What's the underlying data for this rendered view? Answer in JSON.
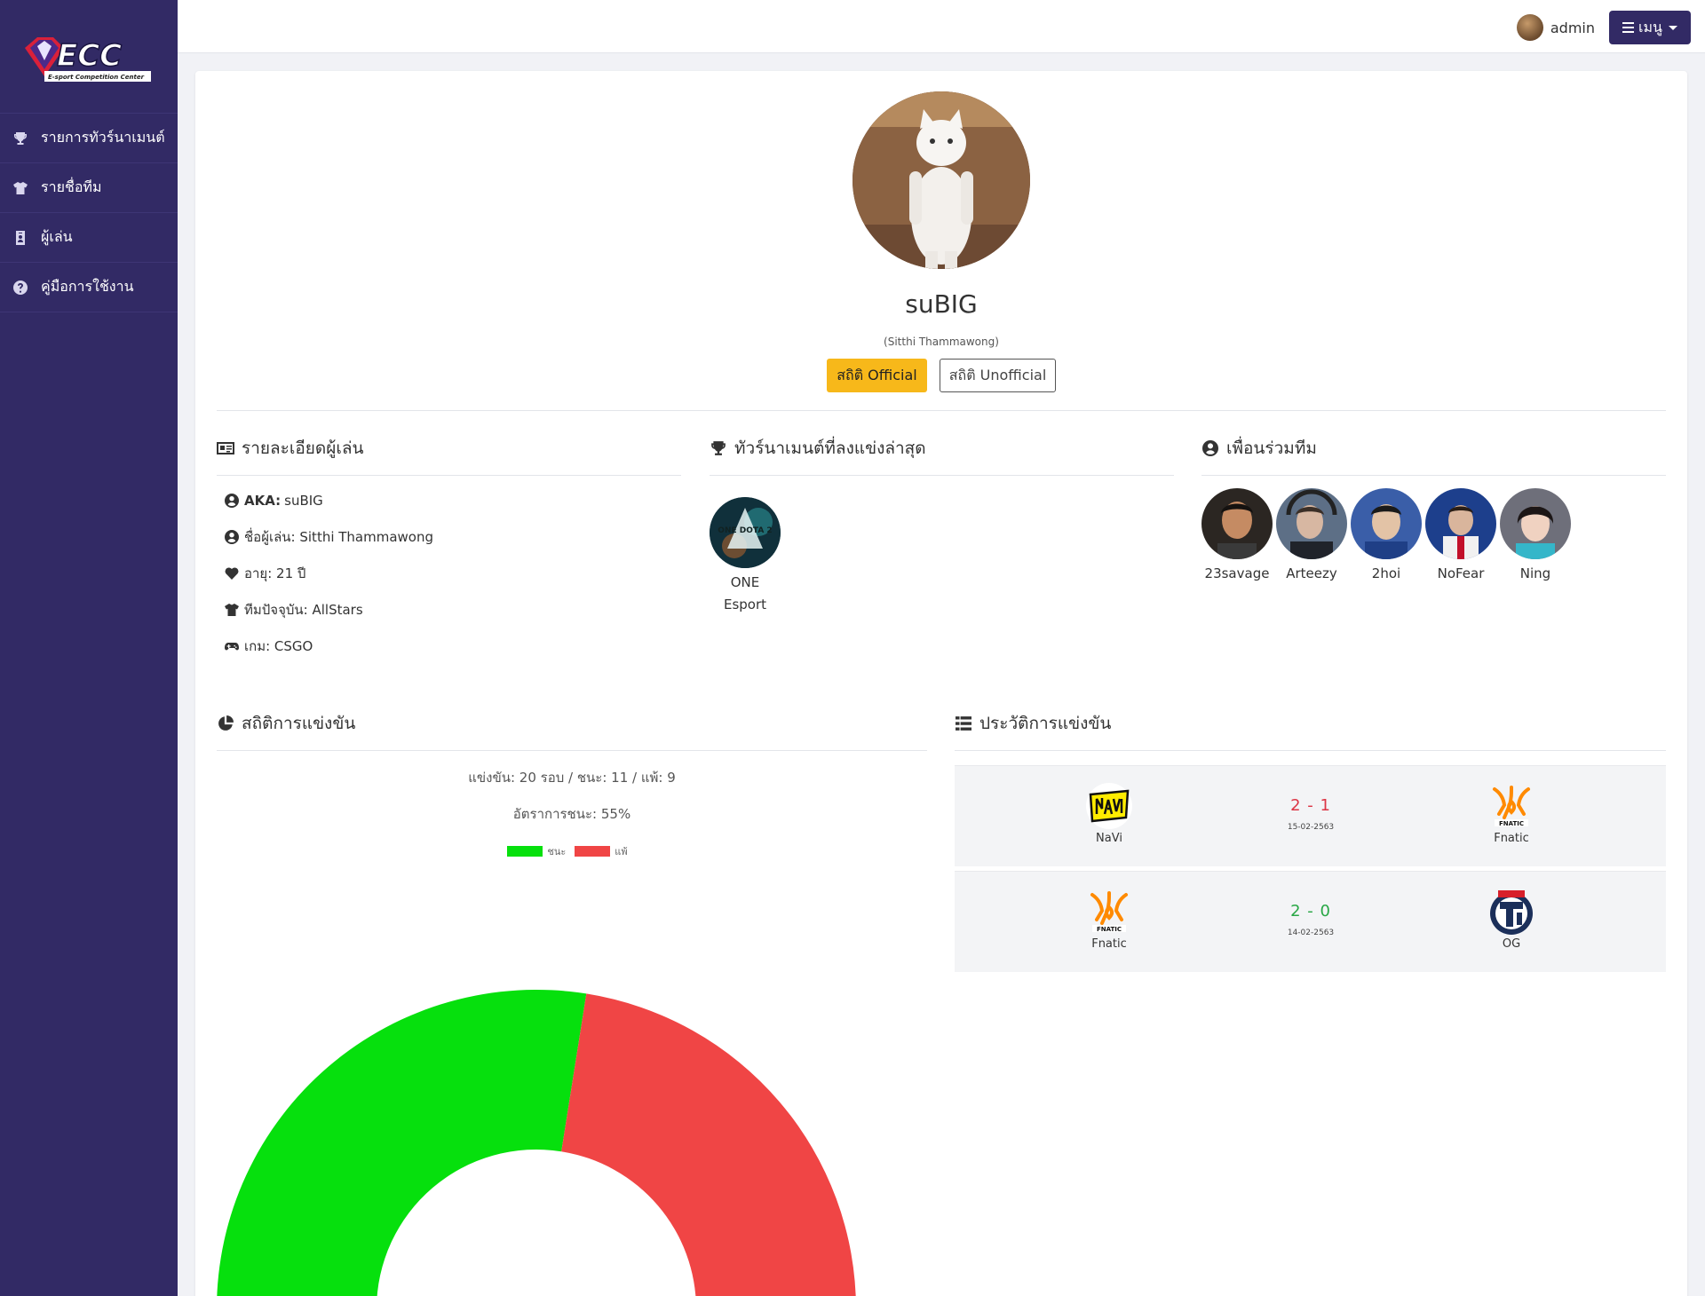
{
  "app": {
    "logo_text": "ECC",
    "logo_subtitle": "E-sport Competition Center"
  },
  "sidebar": {
    "items": [
      {
        "label": "รายการทัวร์นาเมนต์",
        "icon": "trophy-icon"
      },
      {
        "label": "รายชื่อทีม",
        "icon": "tshirt-icon"
      },
      {
        "label": "ผู้เล่น",
        "icon": "id-badge-icon"
      },
      {
        "label": "คู่มือการใช้งาน",
        "icon": "question-circle-icon"
      }
    ]
  },
  "topbar": {
    "username": "admin",
    "menu_label": "เมนู"
  },
  "profile": {
    "name": "suBIG",
    "real_name": "(Sitthi Thammawong)",
    "btn_official": "สถิติ Official",
    "btn_unofficial": "สถิติ Unofficial"
  },
  "details": {
    "title": "รายละเอียดผู้เล่น",
    "aka_label": "AKA:",
    "aka_value": "suBIG",
    "player_name": "ชื่อผู้เล่น: Sitthi Thammawong",
    "age": "อายุ: 21 ปี",
    "team": "ทีมปัจจุบัน: AllStars",
    "game": "เกม: CSGO"
  },
  "tournaments": {
    "title": "ทัวร์นาเมนต์ที่ลงแข่งล่าสุด",
    "items": [
      {
        "name_line1": "ONE",
        "name_line2": "Esport",
        "logo_text": "ONE DOTA 2"
      }
    ]
  },
  "teammates": {
    "title": "เพื่อนร่วมทีม",
    "items": [
      {
        "name": "23savage"
      },
      {
        "name": "Arteezy"
      },
      {
        "name": "2hoi"
      },
      {
        "name": "NoFear"
      },
      {
        "name": "Ning"
      }
    ]
  },
  "stats": {
    "title": "สถิติการแข่งขัน",
    "summary": "แข่งขัน: 20 รอบ / ชนะ: 11 / แพ้: 9",
    "win_rate": "อัตราการชนะ: 55%",
    "legend_win": "ชนะ",
    "legend_lose": "แพ้"
  },
  "chart_data": {
    "type": "pie",
    "categories": [
      "ชนะ",
      "แพ้"
    ],
    "values": [
      11,
      9
    ],
    "colors": [
      "#06e00d",
      "#f04545"
    ],
    "half_doughnut": true
  },
  "history": {
    "title": "ประวัติการแข่งขัน",
    "matches": [
      {
        "team1": "NaVi",
        "team2": "Fnatic",
        "score": "2 - 1",
        "date": "15-02-2563",
        "score_color": "#dc3545"
      },
      {
        "team1": "Fnatic",
        "team2": "OG",
        "score": "2 - 0",
        "date": "14-02-2563",
        "score_color": "#28a745"
      }
    ]
  },
  "colors": {
    "sidebar": "#322a65",
    "accent": "#f7b81a",
    "win": "#06e00d",
    "lose": "#f04545"
  }
}
